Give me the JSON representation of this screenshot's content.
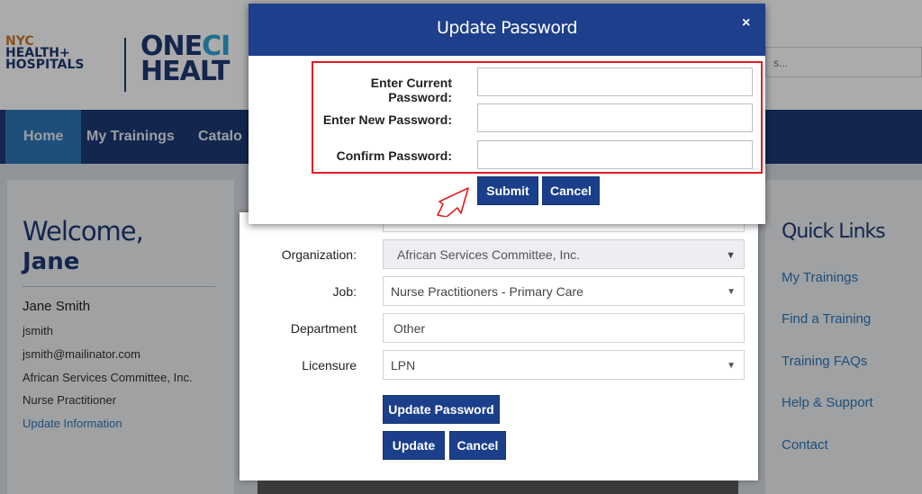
{
  "header": {
    "logo_line1": "NYC",
    "logo_line2": "HEALTH+",
    "logo_line3": "HOSPITALS",
    "logo_onecity_a": "ONE",
    "logo_onecity_b": "CI",
    "logo_health": "HEALT",
    "search_placeholder": "s..."
  },
  "nav": {
    "items": [
      {
        "label": "Home"
      },
      {
        "label": "My Trainings"
      },
      {
        "label": "Catalo"
      }
    ]
  },
  "profile": {
    "welcome": "Welcome,",
    "first_name": "Jane",
    "full_name": "Jane Smith",
    "username": "jsmith",
    "email": "jsmith@mailinator.com",
    "organization": "African Services Committee, Inc.",
    "role": "Nurse Practitioner",
    "update_link": "Update Information"
  },
  "quick_links": {
    "title": "Quick Links",
    "items": [
      {
        "label": "My Trainings"
      },
      {
        "label": "Find a Training"
      },
      {
        "label": "Training FAQs"
      },
      {
        "label": "Help & Support"
      },
      {
        "label": "Contact"
      }
    ]
  },
  "form": {
    "organization_label": "Organization:",
    "organization_value": "African Services Committee, Inc.",
    "job_label": "Job:",
    "job_value": "Nurse Practitioners - Primary Care",
    "department_label": "Department",
    "department_value": "Other",
    "licensure_label": "Licensure",
    "licensure_value": "LPN",
    "update_password_button": "Update Password",
    "update_button": "Update",
    "cancel_button": "Cancel"
  },
  "modal": {
    "title": "Update Password",
    "close_glyph": "×",
    "current_password_label": "Enter Current Password:",
    "new_password_label": "Enter New Password:",
    "confirm_password_label": "Confirm Password:",
    "submit_button": "Submit",
    "cancel_button": "Cancel",
    "highlight_color": "#e31b23"
  }
}
